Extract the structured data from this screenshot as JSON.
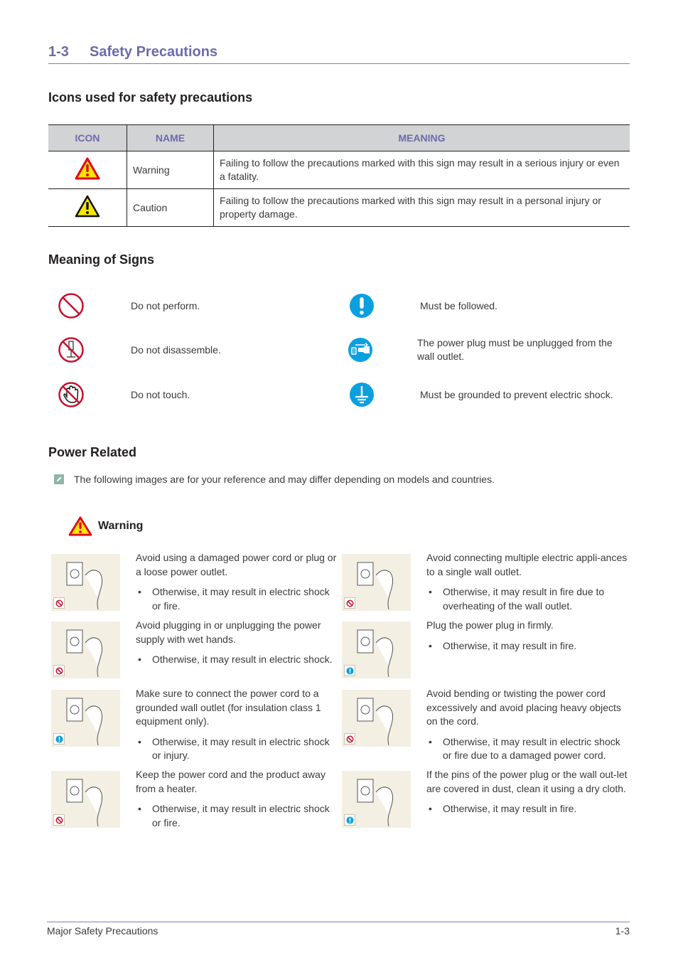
{
  "chapter": {
    "number": "1-3",
    "title": "Safety Precautions"
  },
  "sections": {
    "icons_heading": "Icons used for safety precautions",
    "signs_heading": "Meaning of Signs",
    "power_heading": "Power Related"
  },
  "icon_table": {
    "headers": [
      "ICON",
      "NAME",
      "MEANING"
    ],
    "rows": [
      {
        "icon": "warning-triangle-red-icon",
        "name": "Warning",
        "meaning": "Failing to follow the precautions marked with this sign may result in a serious injury or even a fatality."
      },
      {
        "icon": "caution-triangle-yellow-icon",
        "name": "Caution",
        "meaning": "Failing to follow the precautions marked with this sign may result in a personal injury or property damage."
      }
    ]
  },
  "signs": {
    "left": [
      {
        "icon": "prohibited-icon",
        "text": "Do not perform."
      },
      {
        "icon": "no-disassemble-icon",
        "text": "Do not disassemble."
      },
      {
        "icon": "no-touch-icon",
        "text": "Do not touch."
      }
    ],
    "right": [
      {
        "icon": "must-follow-icon",
        "text": "Must be followed."
      },
      {
        "icon": "unplug-icon",
        "text": "The power plug must be unplugged from the wall outlet."
      },
      {
        "icon": "ground-icon",
        "text": "Must be grounded to prevent electric shock."
      }
    ]
  },
  "note": {
    "icon": "note-pencil-icon",
    "text": "The following images are for your reference and may differ depending on models and countries."
  },
  "warning_label": "Warning",
  "items": [
    {
      "badge": "prohibited",
      "text": "Avoid using a damaged power cord or plug or a loose power outlet.",
      "bullet": "Otherwise, it may result in electric shock or fire."
    },
    {
      "badge": "prohibited",
      "text": "Avoid connecting multiple electric appli-ances to a single wall outlet.",
      "bullet": "Otherwise, it may result in fire due to overheating of the wall outlet."
    },
    {
      "badge": "prohibited",
      "text": "Avoid plugging in or unplugging the power supply with wet hands.",
      "bullet": "Otherwise, it may result in electric shock."
    },
    {
      "badge": "mandatory",
      "text": "Plug the power plug in firmly.",
      "bullet": "Otherwise, it may result in fire."
    },
    {
      "badge": "mandatory",
      "text": "Make sure to connect the power cord to a grounded wall outlet (for insulation class 1 equipment only).",
      "bullet": "Otherwise, it may result in electric shock or injury."
    },
    {
      "badge": "prohibited",
      "text": "Avoid bending or twisting the power cord excessively and avoid placing heavy objects on the cord.",
      "bullet": "Otherwise, it may result in electric shock or fire due to a damaged power cord."
    },
    {
      "badge": "prohibited",
      "text": "Keep the power cord and the product away from a heater.",
      "bullet": "Otherwise, it may result in electric shock or fire."
    },
    {
      "badge": "mandatory",
      "text": "If the pins of the power plug or the wall out-let are covered in dust, clean it using a dry cloth.",
      "bullet": "Otherwise, it may result in fire."
    }
  ],
  "footer": {
    "left": "Major Safety Precautions",
    "right": "1-3"
  },
  "colors": {
    "accent": "#6b6bab",
    "prohibit_red": "#c8102e",
    "mandatory_blue": "#0aa0e0",
    "warning_yellow": "#f7e600"
  }
}
